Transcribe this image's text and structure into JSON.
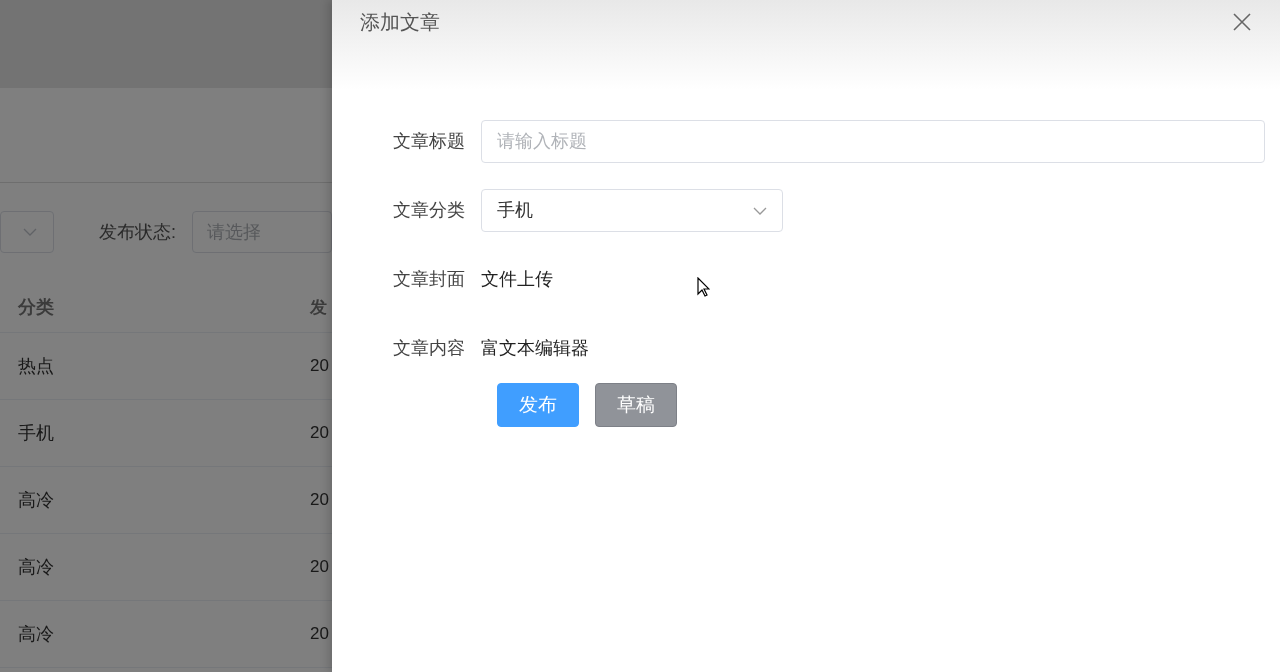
{
  "background_page": {
    "status_filter": {
      "label": "发布状态:",
      "placeholder": "请选择"
    },
    "table": {
      "columns": [
        "分类",
        "发"
      ],
      "rows": [
        [
          "热点",
          "20"
        ],
        [
          "手机",
          "20"
        ],
        [
          "高冷",
          "20"
        ],
        [
          "高冷",
          "20"
        ],
        [
          "高冷",
          "20"
        ]
      ]
    }
  },
  "drawer": {
    "title": "添加文章",
    "fields": [
      {
        "kind": "input",
        "label": "文章标题",
        "placeholder": "请输入标题"
      },
      {
        "kind": "select",
        "label": "文章分类",
        "value": "手机"
      },
      {
        "kind": "text",
        "label": "文章封面",
        "value": "文件上传"
      },
      {
        "kind": "text",
        "label": "文章内容",
        "value": "富文本编辑器"
      }
    ],
    "buttons": [
      {
        "kind": "primary",
        "label": "发布"
      },
      {
        "kind": "info",
        "label": "草稿"
      }
    ]
  }
}
